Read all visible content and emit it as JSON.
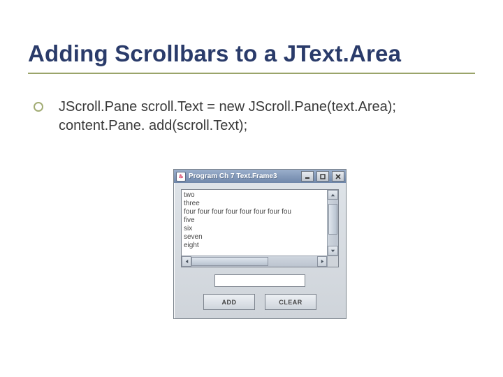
{
  "title": "Adding Scrollbars to a JText.Area",
  "code": {
    "line1": "JScroll.Pane scroll.Text = new JScroll.Pane(text.Area);",
    "line2": "content.Pane. add(scroll.Text);"
  },
  "program": {
    "window_title": "Program Ch 7 Text.Frame3",
    "java_icon_glyph": "♨",
    "text_lines": [
      "two",
      "three",
      "four four four four four four four fou",
      "five",
      "six",
      "seven",
      "eight"
    ],
    "input_value": "",
    "buttons": {
      "add": "ADD",
      "clear": "CLEAR"
    }
  }
}
